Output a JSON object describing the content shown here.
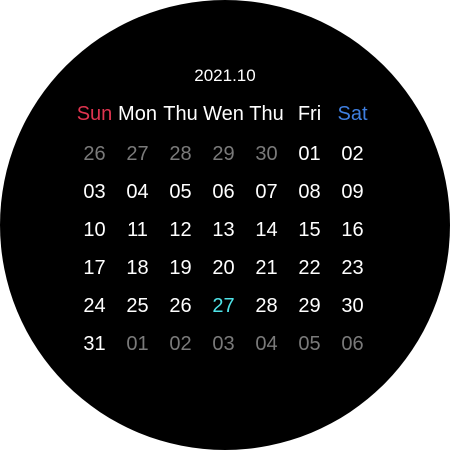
{
  "calendar": {
    "title": "2021.10",
    "weekdays": [
      {
        "label": "Sun",
        "color": "#e0344f"
      },
      {
        "label": "Mon",
        "color": "#ffffff"
      },
      {
        "label": "Thu",
        "color": "#ffffff"
      },
      {
        "label": "Wen",
        "color": "#ffffff"
      },
      {
        "label": "Thu",
        "color": "#ffffff"
      },
      {
        "label": "Fri",
        "color": "#ffffff"
      },
      {
        "label": "Sat",
        "color": "#3f7fe0"
      }
    ],
    "days": [
      {
        "label": "26",
        "state": "muted"
      },
      {
        "label": "27",
        "state": "muted"
      },
      {
        "label": "28",
        "state": "muted"
      },
      {
        "label": "29",
        "state": "muted"
      },
      {
        "label": "30",
        "state": "muted"
      },
      {
        "label": "01",
        "state": "current"
      },
      {
        "label": "02",
        "state": "current"
      },
      {
        "label": "03",
        "state": "current"
      },
      {
        "label": "04",
        "state": "current"
      },
      {
        "label": "05",
        "state": "current"
      },
      {
        "label": "06",
        "state": "current"
      },
      {
        "label": "07",
        "state": "current"
      },
      {
        "label": "08",
        "state": "current"
      },
      {
        "label": "09",
        "state": "current"
      },
      {
        "label": "10",
        "state": "current"
      },
      {
        "label": "11",
        "state": "current"
      },
      {
        "label": "12",
        "state": "current"
      },
      {
        "label": "13",
        "state": "current"
      },
      {
        "label": "14",
        "state": "current"
      },
      {
        "label": "15",
        "state": "current"
      },
      {
        "label": "16",
        "state": "current"
      },
      {
        "label": "17",
        "state": "current"
      },
      {
        "label": "18",
        "state": "current"
      },
      {
        "label": "19",
        "state": "current"
      },
      {
        "label": "20",
        "state": "current"
      },
      {
        "label": "21",
        "state": "current"
      },
      {
        "label": "22",
        "state": "current"
      },
      {
        "label": "23",
        "state": "current"
      },
      {
        "label": "24",
        "state": "current"
      },
      {
        "label": "25",
        "state": "current"
      },
      {
        "label": "26",
        "state": "current"
      },
      {
        "label": "27",
        "state": "today"
      },
      {
        "label": "28",
        "state": "current"
      },
      {
        "label": "29",
        "state": "current"
      },
      {
        "label": "30",
        "state": "current"
      },
      {
        "label": "31",
        "state": "current"
      },
      {
        "label": "01",
        "state": "muted"
      },
      {
        "label": "02",
        "state": "muted"
      },
      {
        "label": "03",
        "state": "muted"
      },
      {
        "label": "04",
        "state": "muted"
      },
      {
        "label": "05",
        "state": "muted"
      },
      {
        "label": "06",
        "state": "muted"
      }
    ]
  },
  "colors": {
    "background": "#000000",
    "text": "#ffffff",
    "muted": "#7a7a7a",
    "today": "#4fe3e8",
    "sunday": "#e0344f",
    "saturday": "#3f7fe0"
  }
}
